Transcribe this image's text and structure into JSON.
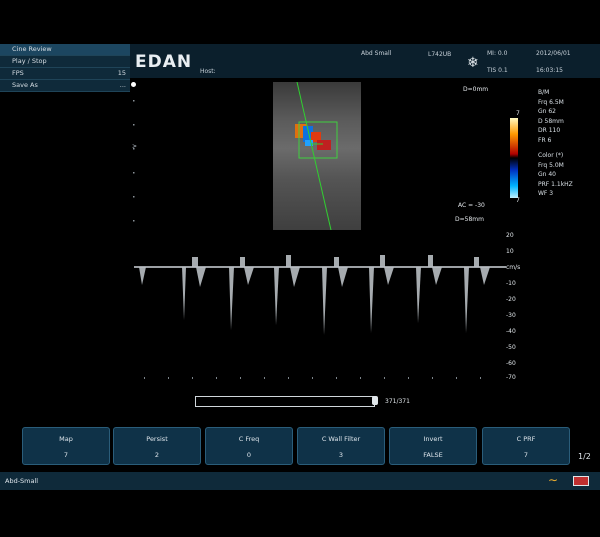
{
  "menu": {
    "items": [
      {
        "label": "Cine Review",
        "value": ""
      },
      {
        "label": "Play / Stop",
        "value": ""
      },
      {
        "label": "FPS",
        "value": "15"
      },
      {
        "label": "Save As",
        "value": "..."
      }
    ]
  },
  "header": {
    "brand": "EDAN",
    "host_label": "Host:",
    "exam": "Abd Small",
    "probe": "L742UB",
    "mi": "MI: 0.0",
    "tis": "TIS 0.1",
    "date": "2012/06/01",
    "time": "16:03:15"
  },
  "image": {
    "depth_top": "D=0mm",
    "ac": "AC = -30",
    "depth_gate": "D=58mm",
    "scale_top": "7",
    "scale_bottom": "7"
  },
  "params": {
    "bm": "B/M",
    "frq": "Frq  6.5M",
    "gn": "Gn  62",
    "d": "D  58mm",
    "dr": "DR  110",
    "fr": "FR  6",
    "color_hdr": "Color (*)",
    "cfrq": "Frq  5.0M",
    "cgn": "Gn  40",
    "prf": "PRF  1.1kHZ",
    "wf": "WF  3"
  },
  "yaxis": {
    "unit": "cm/s",
    "ticks": [
      "20",
      "10",
      "-10",
      "-20",
      "-30",
      "-40",
      "-50",
      "-60",
      "-70"
    ]
  },
  "progress": {
    "label": "371/371",
    "fraction": 1.0
  },
  "buttons": [
    {
      "title": "Map",
      "value": "7"
    },
    {
      "title": "Persist",
      "value": "2"
    },
    {
      "title": "C Freq",
      "value": "0"
    },
    {
      "title": "C Wall Filter",
      "value": "3"
    },
    {
      "title": "Invert",
      "value": "FALSE"
    },
    {
      "title": "C PRF",
      "value": "7"
    }
  ],
  "page_indicator": "1/2",
  "status": "Abd-Small",
  "colors": {
    "panel": "#0f2a3a",
    "button": "#0f3248",
    "accent": "#f0b030"
  }
}
